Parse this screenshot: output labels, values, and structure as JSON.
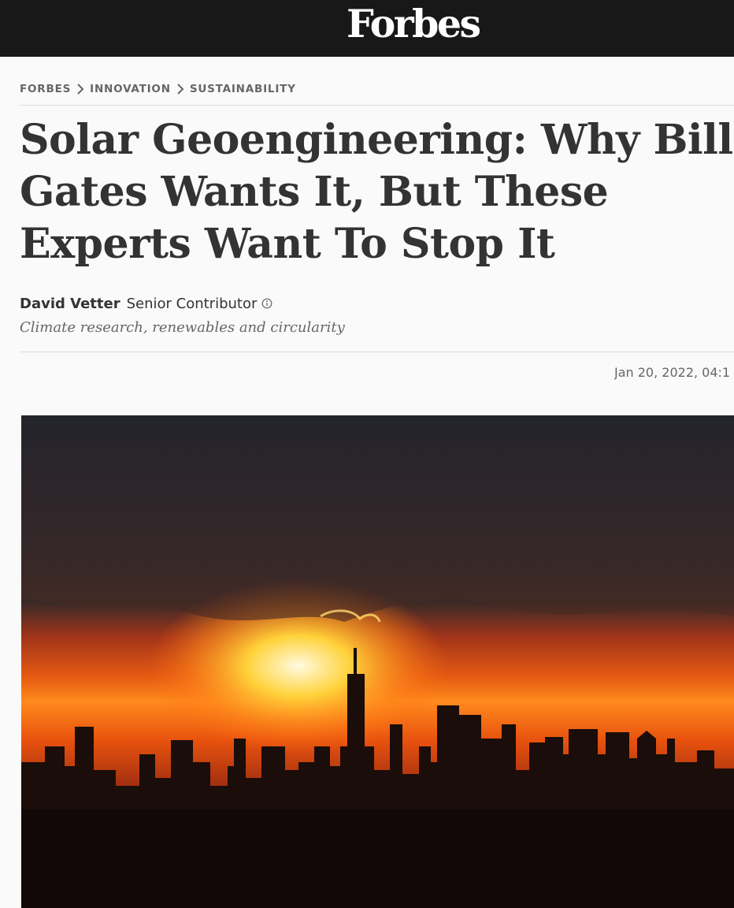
{
  "brand": {
    "logo_text": "Forbes"
  },
  "breadcrumb": {
    "items": [
      "FORBES",
      "INNOVATION",
      "SUSTAINABILITY"
    ]
  },
  "article": {
    "headline": "Solar Geoengineering: Why Bill Gates Wants It, But These Experts Want To Stop It",
    "author": "David Vetter",
    "author_role": "Senior Contributor",
    "author_tagline": "Climate research, renewables and circularity",
    "timestamp": "Jan 20, 2022, 04:1"
  },
  "colors": {
    "topbar": "#181818",
    "text": "#333333",
    "muted": "#666666",
    "rule": "#dddddd"
  },
  "icons": {
    "breadcrumb_separator": "chevron-right-icon",
    "author_info": "info-icon"
  }
}
